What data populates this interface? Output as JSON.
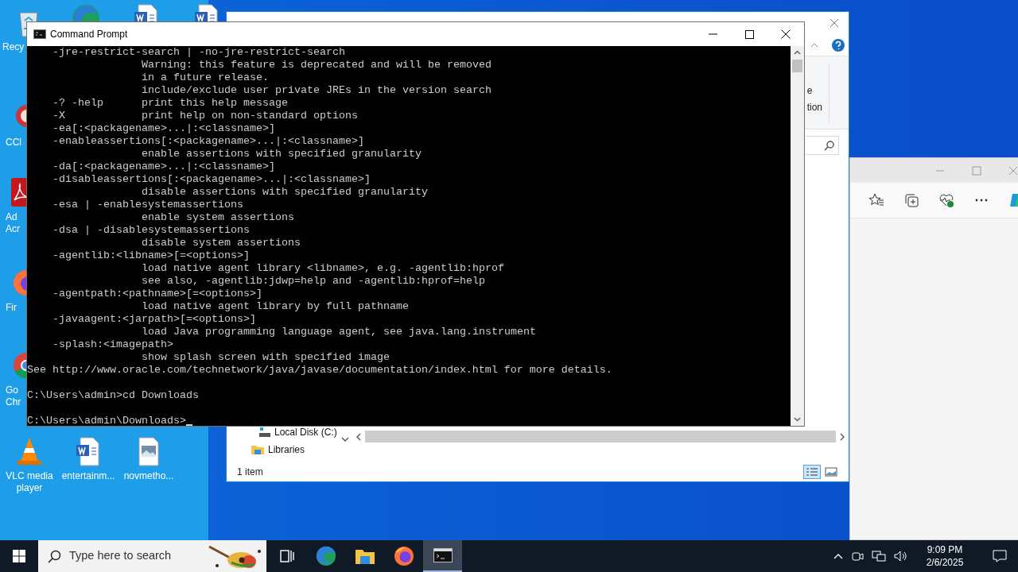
{
  "desktop_icons": [
    {
      "kind": "recycle",
      "label": [
        "Recy"
      ]
    },
    {
      "kind": "edge"
    },
    {
      "kind": "word"
    },
    {
      "kind": "word"
    },
    {
      "kind": "ccleaner",
      "label": [
        "CCl"
      ]
    },
    {
      "kind": "acrobat",
      "label": [
        "Ad",
        "Acr"
      ]
    },
    {
      "kind": "firefox",
      "label": [
        "Fir"
      ]
    },
    {
      "kind": "chrome",
      "label": [
        "Go",
        "Chr"
      ]
    },
    {
      "kind": "vlc",
      "label": [
        "VLC media",
        "player"
      ]
    },
    {
      "kind": "word",
      "label": [
        "entertainm..."
      ]
    },
    {
      "kind": "image",
      "label": [
        "novmetho..."
      ]
    }
  ],
  "explorer": {
    "ribbon_fragments": [
      "e",
      "tion"
    ],
    "nav_items": [
      {
        "kind": "drive",
        "label": "Local Disk (C:)"
      },
      {
        "kind": "folder",
        "label": "Libraries"
      }
    ],
    "status": "1 item"
  },
  "command_prompt": {
    "title": "Command Prompt",
    "lines": [
      {
        "kind": "option",
        "text": "-jre-restrict-search | -no-jre-restrict-search"
      },
      {
        "kind": "detail",
        "text": "Warning: this feature is deprecated and will be removed"
      },
      {
        "kind": "detail",
        "text": "in a future release."
      },
      {
        "kind": "detail",
        "text": "include/exclude user private JREs in the version search"
      },
      {
        "kind": "option",
        "text": "-? -help",
        "description": "print this help message"
      },
      {
        "kind": "option",
        "text": "-X",
        "description": "print help on non-standard options"
      },
      {
        "kind": "option",
        "text": "-ea[:<packagename>...|:<classname>]"
      },
      {
        "kind": "option",
        "text": "-enableassertions[:<packagename>...|:<classname>]"
      },
      {
        "kind": "detail",
        "text": "enable assertions with specified granularity"
      },
      {
        "kind": "option",
        "text": "-da[:<packagename>...|:<classname>]"
      },
      {
        "kind": "option",
        "text": "-disableassertions[:<packagename>...|:<classname>]"
      },
      {
        "kind": "detail",
        "text": "disable assertions with specified granularity"
      },
      {
        "kind": "option",
        "text": "-esa | -enablesystemassertions"
      },
      {
        "kind": "detail",
        "text": "enable system assertions"
      },
      {
        "kind": "option",
        "text": "-dsa | -disablesystemassertions"
      },
      {
        "kind": "detail",
        "text": "disable system assertions"
      },
      {
        "kind": "option",
        "text": "-agentlib:<libname>[=<options>]"
      },
      {
        "kind": "detail",
        "text": "load native agent library <libname>, e.g. -agentlib:hprof"
      },
      {
        "kind": "detail",
        "text": "see also, -agentlib:jdwp=help and -agentlib:hprof=help"
      },
      {
        "kind": "option",
        "text": "-agentpath:<pathname>[=<options>]"
      },
      {
        "kind": "detail",
        "text": "load native agent library by full pathname"
      },
      {
        "kind": "option",
        "text": "-javaagent:<jarpath>[=<options>]"
      },
      {
        "kind": "detail",
        "text": "load Java programming language agent, see java.lang.instrument"
      },
      {
        "kind": "option",
        "text": "-splash:<imagepath>"
      },
      {
        "kind": "detail",
        "text": "show splash screen with specified image"
      },
      {
        "kind": "plain",
        "text": "See http://www.oracle.com/technetwork/java/javase/documentation/index.html for more details."
      },
      {
        "kind": "blank"
      },
      {
        "kind": "plain",
        "text": "C:\\Users\\admin>cd Downloads"
      },
      {
        "kind": "blank"
      },
      {
        "kind": "prompt",
        "text": "C:\\Users\\admin\\Downloads>"
      }
    ]
  },
  "taskbar": {
    "search_placeholder": "Type here to search",
    "apps": [
      {
        "kind": "taskview",
        "selected": false
      },
      {
        "kind": "edge",
        "selected": false
      },
      {
        "kind": "explorer",
        "selected": false
      },
      {
        "kind": "firefox",
        "selected": false
      },
      {
        "kind": "cmd",
        "selected": true
      }
    ],
    "time": "9:09 PM",
    "date": "2/6/2025"
  }
}
